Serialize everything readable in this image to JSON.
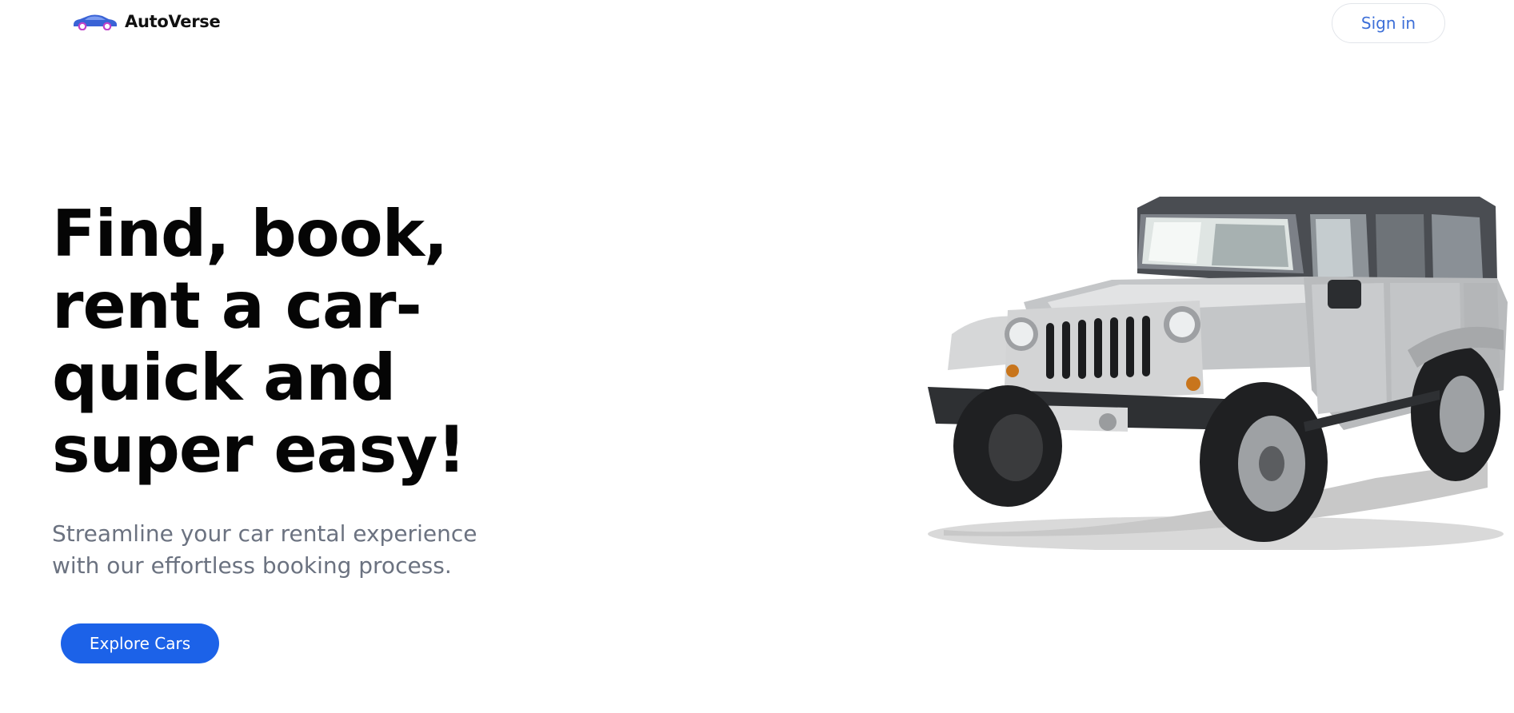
{
  "header": {
    "brand_name": "AutoVerse",
    "logo_icon": "car-logo-icon",
    "signin_label": "Sign in"
  },
  "hero": {
    "title_lines": [
      "Find, book,",
      "rent a car-",
      "quick and",
      "super easy!"
    ],
    "subtitle_lines": [
      "Streamline your car rental experience",
      "with our effortless booking process."
    ],
    "cta_label": "Explore Cars",
    "image": "silver-jeep-wrangler-image"
  },
  "colors": {
    "accent": "#1c62e8",
    "signin_text": "#3d6fd8",
    "title": "#050505",
    "subtitle": "#6b7280",
    "logo_body": "#3a63d6",
    "logo_accent": "#c043c9"
  }
}
